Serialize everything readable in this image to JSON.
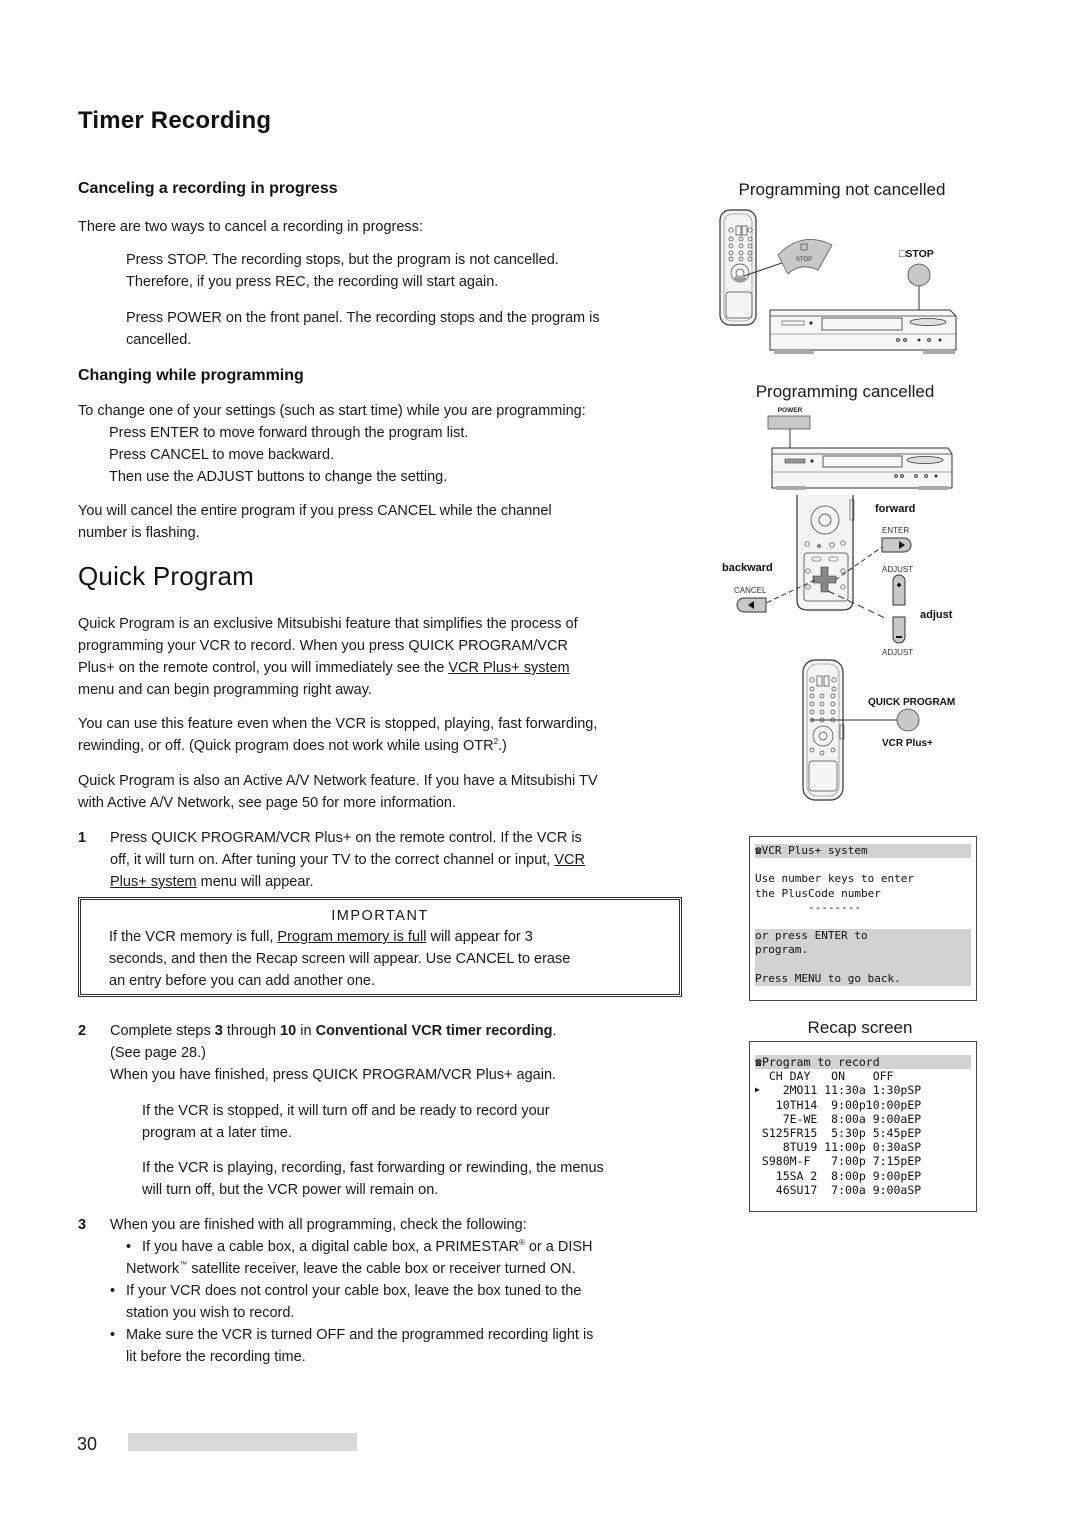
{
  "page": {
    "title": "Timer Recording",
    "page_number": "30"
  },
  "canceling": {
    "heading": "Canceling a recording in progress",
    "intro": "There are two ways to cancel a recording in progress:",
    "way1_line1": "Press STOP. The recording stops, but the program is not cancelled.",
    "way1_line2": "Therefore, if you press REC, the recording will start again.",
    "way2_line1": "Press POWER on the front panel. The recording stops and the program is",
    "way2_line2": "cancelled."
  },
  "changing": {
    "heading": "Changing while programming",
    "line1": "To change one of your settings (such as start time) while you are programming:",
    "line2": "Press ENTER to move forward through the program list.",
    "line3": "Press CANCEL to move backward.",
    "line4": "Then use the ADJUST buttons to change the setting.",
    "note_line1": "You will cancel the entire program if you press CANCEL while the channel",
    "note_line2": "number is flashing."
  },
  "quick_program": {
    "heading": "Quick Program",
    "p1_line1": "Quick Program is an exclusive Mitsubishi feature that simplifies the process of",
    "p1_line2": "programming your VCR to record. When you press QUICK PROGRAM/VCR",
    "p1_line3_pre": "Plus+ on the remote control, you will immediately see the ",
    "p1_line3_link": "VCR Plus+ system",
    "p1_line4": "menu and can begin programming right away.",
    "p2_line1": "You can use this feature even when the VCR is stopped, playing, fast forwarding,",
    "p2_line2_pre": "rewinding, or off.  (Quick program does not work while using OTR",
    "p2_line2_sup": "2",
    "p2_line2_post": ".)",
    "p3_line1": "Quick Program is also an Active A/V Network feature.  If you have a Mitsubishi TV",
    "p3_line2": "with Active A/V Network, see page 50 for more information."
  },
  "steps": {
    "s1_num": "1",
    "s1_line1": "Press QUICK PROGRAM/VCR Plus+ on the remote control.  If the VCR is",
    "s1_line2_pre": "off, it will turn on. After tuning your TV to the correct channel or input, ",
    "s1_line2_link": "VCR",
    "s1_line3_link": "Plus+ system",
    "s1_line3_post": " menu will appear.",
    "s2_num": "2",
    "s2_pre": "Complete steps ",
    "s2_b1": "3",
    "s2_mid1": " through ",
    "s2_b2": "10",
    "s2_mid2": " in ",
    "s2_b3": "Conventional VCR timer recording",
    "s2_post": ".",
    "s2_line2": "(See page 28.)",
    "s2_line3": "When you have finished, press QUICK PROGRAM/VCR Plus+ again.",
    "s2_a_line1": "If the VCR is stopped, it will turn off and be ready to record your",
    "s2_a_line2": "program at a later time.",
    "s2_b_line1": "If the VCR is playing, recording, fast forwarding or rewinding, the menus",
    "s2_b_line2": "will turn off, but the VCR power will remain on.",
    "s3_num": "3",
    "s3_line1": "When you are finished with all programming, check the following:",
    "bullet1_line1_pre": "If you have a cable box, a digital cable box, a PRIMESTAR",
    "bullet1_reg": "®",
    "bullet1_line1_post": " or a DISH",
    "bullet1_line2_pre": "Network",
    "bullet1_tm": "™",
    "bullet1_line2_post": " satellite receiver, leave the cable box or receiver turned ON.",
    "bullet2_line1": "If your VCR does not control your cable box, leave the box tuned to the",
    "bullet2_line2": "station you wish to record.",
    "bullet3_line1": "Make sure the VCR is turned OFF and the programmed recording light is",
    "bullet3_line2": "lit before the recording time.",
    "bullet_glyph": "•"
  },
  "important": {
    "heading": "IMPORTANT",
    "line1_pre": "If the VCR memory is full, ",
    "line1_link": "Program memory is full",
    "line1_post": " will appear for 3",
    "line2": "seconds, and then the Recap screen will appear.  Use CANCEL to erase",
    "line3": "an entry before you can add another one."
  },
  "figures": {
    "not_cancelled_caption": "Programming not cancelled",
    "stop_label": "STOP",
    "stop_label_panel": "□STOP",
    "cancelled_caption": "Programming cancelled",
    "power_label": "POWER",
    "forward_label": "forward",
    "enter_label": "ENTER",
    "backward_label": "backward",
    "cancel_label": "CANCEL",
    "adjust_label_top": "ADJUST",
    "adjust_label": "adjust",
    "adjust_label_bottom": "ADJUST",
    "quick_program_label": "QUICK PROGRAM",
    "vcr_plus_label": "VCR Plus+",
    "recap_caption": "Recap screen"
  },
  "osd_vcrplus": {
    "icon": "phone-icon",
    "title": "VCR Plus+ system",
    "line1": "Use number keys to enter",
    "line2": "the PlusCode number",
    "line3": "        --------",
    "line4": "or press ENTER to",
    "line5": "program.",
    "line6": "Press MENU to go back."
  },
  "osd_recap": {
    "icon": "phone-icon",
    "title": "Program to record",
    "header": "  CH DAY   ON    OFF",
    "cursor": "▶",
    "rows": [
      "    2MO11 11:30a 1:30pSP",
      "   10TH14  9:00p10:00pEP",
      "    7E-WE  8:00a 9:00aEP",
      " S125FR15  5:30p 5:45pEP",
      "    8TU19 11:00p 0:30aSP",
      " S980M-F   7:00p 7:15pEP",
      "   15SA 2  8:00p 9:00pEP",
      "   46SU17  7:00a 9:00aSP"
    ]
  }
}
